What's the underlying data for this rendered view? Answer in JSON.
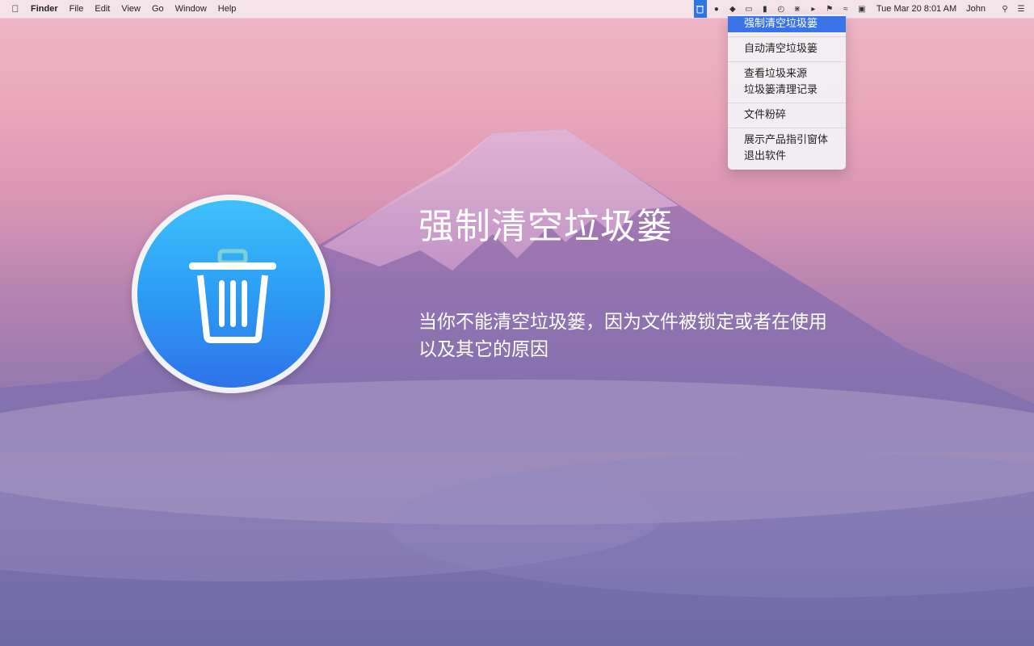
{
  "menubar": {
    "app_name": "Finder",
    "menus": [
      "File",
      "Edit",
      "View",
      "Go",
      "Window",
      "Help"
    ],
    "clock": "Tue Mar 20  8:01 AM",
    "user": "John"
  },
  "dropdown": {
    "items": [
      {
        "label": "强制清空垃圾篓",
        "selected": true
      },
      {
        "label": "自动清空垃圾篓"
      },
      {
        "label": "查看垃圾来源"
      },
      {
        "label": "垃圾篓清理记录"
      },
      {
        "label": "文件粉碎"
      },
      {
        "label": "展示产品指引窗体"
      },
      {
        "label": "退出软件"
      }
    ]
  },
  "hero": {
    "title": "强制清空垃圾篓",
    "description_line1": "当你不能清空垃圾篓，因为文件被锁定或者在使用",
    "description_line2": "以及其它的原因"
  },
  "colors": {
    "accent": "#3a74e8",
    "icon_blue_top": "#3fc0fb",
    "icon_blue_bottom": "#2f73ea"
  }
}
